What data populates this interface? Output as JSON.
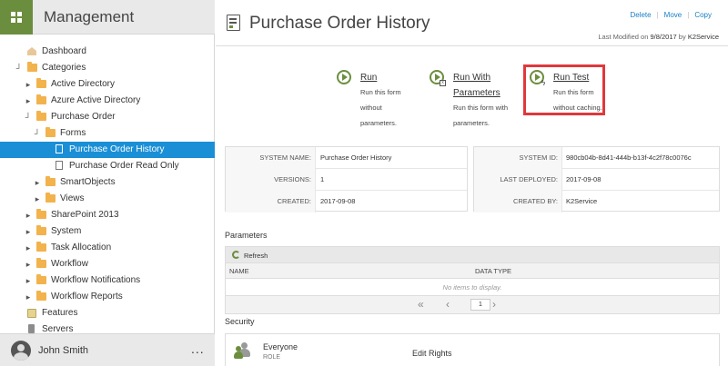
{
  "app": {
    "title": "Management"
  },
  "sidebar": {
    "items": [
      {
        "label": "Dashboard"
      },
      {
        "label": "Categories"
      },
      {
        "label": "Active Directory"
      },
      {
        "label": "Azure Active Directory"
      },
      {
        "label": "Purchase Order"
      },
      {
        "label": "Forms"
      },
      {
        "label": "Purchase Order History"
      },
      {
        "label": "Purchase Order Read Only"
      },
      {
        "label": "SmartObjects"
      },
      {
        "label": "Views"
      },
      {
        "label": "SharePoint 2013"
      },
      {
        "label": "System"
      },
      {
        "label": "Task Allocation"
      },
      {
        "label": "Workflow"
      },
      {
        "label": "Workflow Notifications"
      },
      {
        "label": "Workflow Reports"
      },
      {
        "label": "Features"
      },
      {
        "label": "Servers"
      }
    ],
    "user": {
      "name": "John Smith",
      "more": "..."
    }
  },
  "header": {
    "title": "Purchase Order History",
    "actions": {
      "delete": "Delete",
      "move": "Move",
      "copy": "Copy",
      "sep": "|"
    },
    "last_modified_prefix": "Last Modified on",
    "last_modified_date": "9/8/2017",
    "last_modified_by_prefix": "by",
    "last_modified_by": "K2Service"
  },
  "run_options": [
    {
      "title": "Run",
      "desc": [
        "Run this form",
        "without",
        "parameters."
      ]
    },
    {
      "title": "Run With Parameters",
      "title_lines": [
        "Run With",
        "Parameters"
      ],
      "desc": [
        "Run this form with",
        "parameters."
      ]
    },
    {
      "title": "Run Test",
      "desc": [
        "Run this form",
        "without caching."
      ]
    }
  ],
  "info": {
    "left": [
      {
        "label": "SYSTEM NAME:",
        "value": "Purchase Order History"
      },
      {
        "label": "VERSIONS:",
        "value": "1"
      },
      {
        "label": "CREATED:",
        "value": "2017-09-08"
      }
    ],
    "right": [
      {
        "label": "SYSTEM ID:",
        "value": "980cb04b-8d41-444b-b13f-4c2f78c0076c"
      },
      {
        "label": "LAST DEPLOYED:",
        "value": "2017-09-08"
      },
      {
        "label": "CREATED BY:",
        "value": "K2Service"
      }
    ]
  },
  "parameters": {
    "title": "Parameters",
    "refresh_label": "Refresh",
    "columns": [
      "NAME",
      "DATA TYPE"
    ],
    "empty_text": "No items to display.",
    "page_input": "1"
  },
  "security": {
    "title": "Security",
    "rows": [
      {
        "name": "Everyone",
        "type": "ROLE",
        "rights": "Edit Rights"
      }
    ]
  },
  "colors": {
    "accent": "#1a8fd6",
    "brand": "#6b8e3e",
    "highlight": "#e0383c",
    "link": "#1a7dc4"
  }
}
